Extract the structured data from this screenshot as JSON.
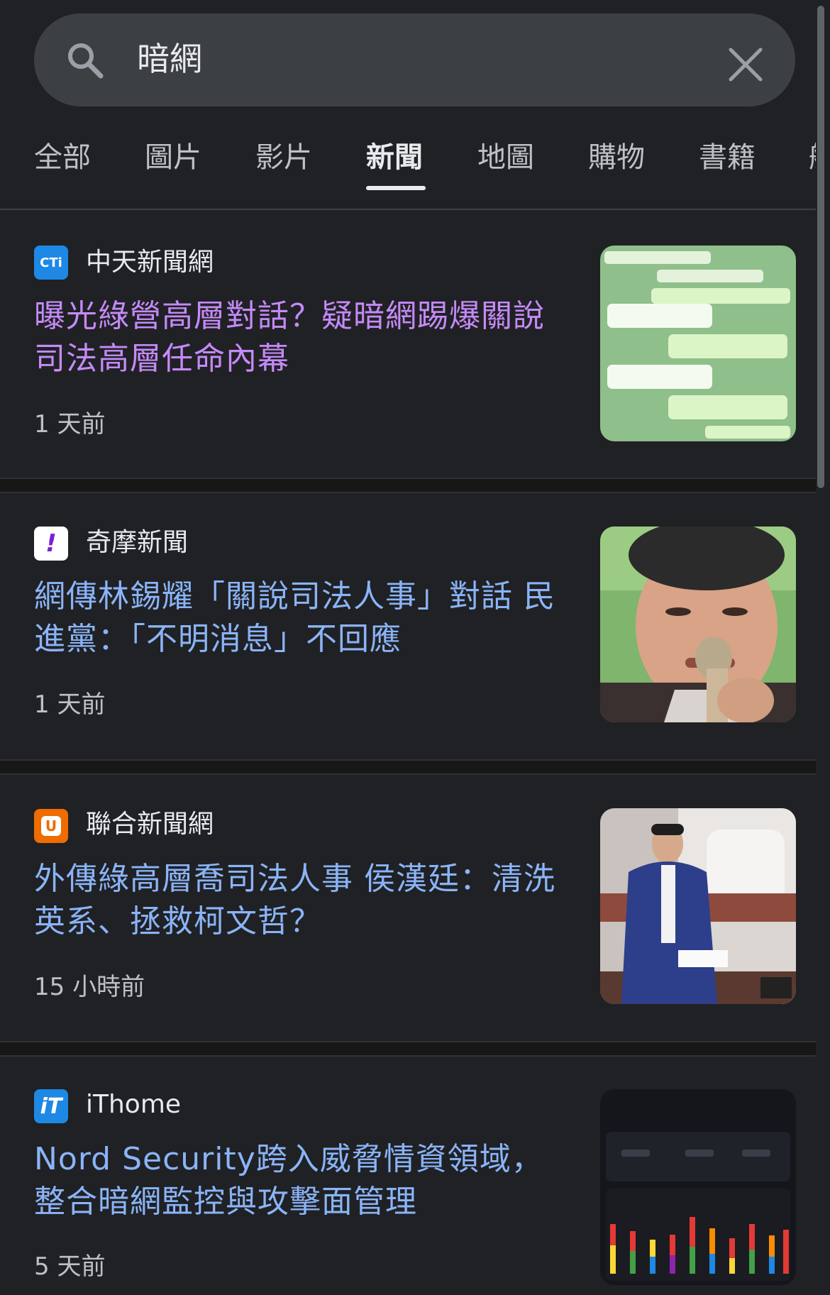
{
  "search": {
    "query": "暗網"
  },
  "tabs": [
    "全部",
    "圖片",
    "影片",
    "新聞",
    "地圖",
    "購物",
    "書籍",
    "航"
  ],
  "active_tab": "新聞",
  "results": [
    {
      "source": "中天新聞網",
      "logo_text": "CTi",
      "logo_color": "#1e88e5",
      "headline": "曝光綠營高層對話？疑暗網踢爆關說司法高層任命內幕",
      "time": "1 天前",
      "visited": true,
      "thumb_icon": "chat-screenshot-thumbnail"
    },
    {
      "source": "奇摩新聞",
      "logo_text": "!",
      "logo_color": "#ffffff",
      "headline": "網傳林錫耀「關說司法人事」對話 民進黨：「不明消息」不回應",
      "time": "1 天前",
      "visited": false,
      "thumb_icon": "portrait-with-microphone-thumbnail"
    },
    {
      "source": "聯合新聞網",
      "logo_text": "U",
      "logo_color": "#ef6c00",
      "headline": "外傳綠高層喬司法人事 侯漢廷：清洗英系、拯救柯文哲？",
      "time": "15 小時前",
      "visited": false,
      "thumb_icon": "council-speaker-thumbnail"
    },
    {
      "source": "iThome",
      "logo_text": "iT",
      "logo_color": "#1e88e5",
      "headline": "Nord Security跨入威脅情資領域，整合暗網監控與攻擊面管理",
      "time": "5 天前",
      "visited": false,
      "thumb_icon": "dashboard-chart-thumbnail"
    }
  ],
  "colors": {
    "background": "#202124",
    "link": "#8ab4f8",
    "visited_link": "#c58af9",
    "secondary_text": "#bdc1c6"
  }
}
